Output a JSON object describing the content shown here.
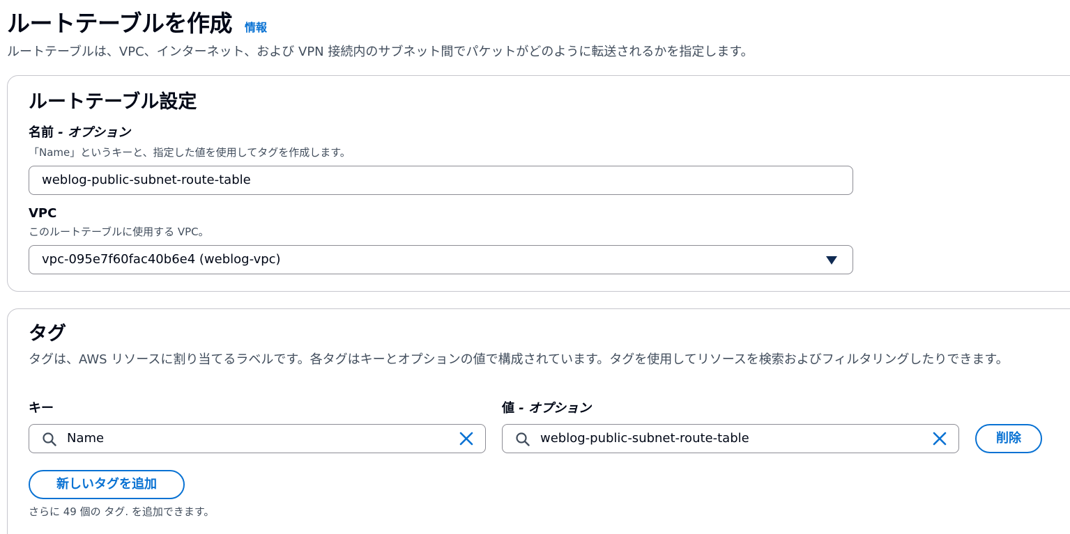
{
  "page": {
    "title": "ルートテーブルを作成",
    "info_link": "情報",
    "description": "ルートテーブルは、VPC、インターネット、および VPN 接続内のサブネット間でパケットがどのように転送されるかを指定します。"
  },
  "settings": {
    "title": "ルートテーブル設定",
    "name_label": "名前",
    "name_optional": " - オプション",
    "name_description": "「Name」というキーと、指定した値を使用してタグを作成します。",
    "name_value": "weblog-public-subnet-route-table",
    "vpc_label": "VPC",
    "vpc_description": "このルートテーブルに使用する VPC。",
    "vpc_value": "vpc-095e7f60fac40b6e4 (weblog-vpc)"
  },
  "tags": {
    "title": "タグ",
    "description": "タグは、AWS リソースに割り当てるラベルです。各タグはキーとオプションの値で構成されています。タグを使用してリソースを検索およびフィルタリングしたりできます。",
    "key_label": "キー",
    "value_label": "値",
    "value_optional": " - オプション",
    "rows": [
      {
        "key": "Name",
        "value": "weblog-public-subnet-route-table",
        "remove_label": "削除"
      }
    ],
    "add_button": "新しいタグを追加",
    "remaining_text": "さらに 49 個の タグ. を追加できます。"
  },
  "colors": {
    "accent": "#0972d3",
    "text": "#000716",
    "secondary_text": "#414d5c",
    "border": "#8c8c94"
  },
  "icons": [
    "search-icon",
    "clear-icon",
    "caret-down-icon"
  ]
}
